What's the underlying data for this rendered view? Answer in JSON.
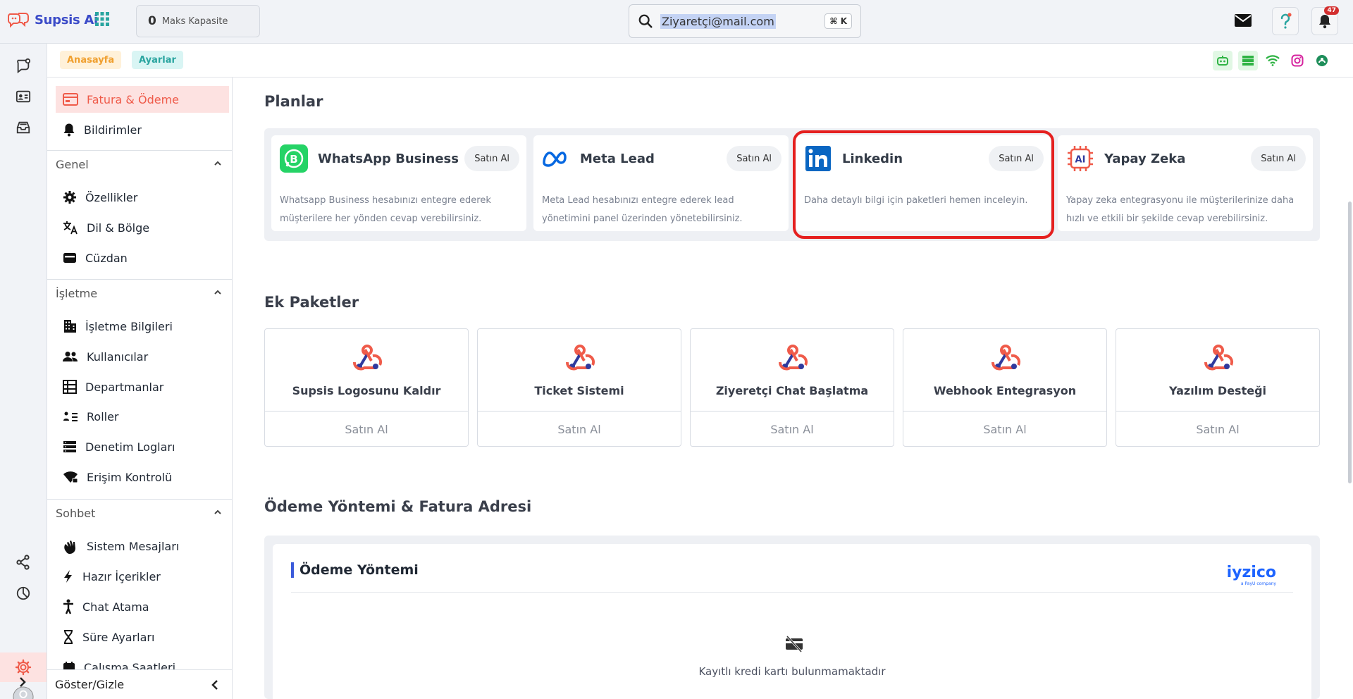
{
  "topbar": {
    "logo_text": "Supsis Ai",
    "capacity_value": "0",
    "capacity_label": "Maks Kapasite",
    "search_value": "Ziyaretçi@mail.com",
    "search_shortcut": "⌘ K",
    "notification_count": "47"
  },
  "breadcrumbs": [
    "Anasayfa",
    "Ayarlar"
  ],
  "sidebar": {
    "top_items": [
      {
        "label": "Fatura & Ödeme",
        "icon": "invoice-icon",
        "active": true
      },
      {
        "label": "Bildirimler",
        "icon": "bell-icon"
      }
    ],
    "sections": [
      {
        "title": "Genel",
        "items": [
          {
            "label": "Özellikler",
            "icon": "gear-icon"
          },
          {
            "label": "Dil & Bölge",
            "icon": "translate-icon"
          },
          {
            "label": "Cüzdan",
            "icon": "wallet-icon"
          }
        ]
      },
      {
        "title": "İşletme",
        "items": [
          {
            "label": "İşletme Bilgileri",
            "icon": "building-icon"
          },
          {
            "label": "Kullanıcılar",
            "icon": "users-icon"
          },
          {
            "label": "Departmanlar",
            "icon": "department-icon"
          },
          {
            "label": "Roller",
            "icon": "roles-icon"
          },
          {
            "label": "Denetim Logları",
            "icon": "logs-icon"
          },
          {
            "label": "Erişim Kontrolü",
            "icon": "access-icon"
          }
        ]
      },
      {
        "title": "Sohbet",
        "items": [
          {
            "label": "Sistem Mesajları",
            "icon": "hand-wave-icon"
          },
          {
            "label": "Hazır İçerikler",
            "icon": "bolt-icon"
          },
          {
            "label": "Chat Atama",
            "icon": "person-icon"
          },
          {
            "label": "Süre Ayarları",
            "icon": "hourglass-icon"
          },
          {
            "label": "Çalışma Saatleri",
            "icon": "calendar-icon"
          }
        ]
      }
    ],
    "footer_label": "Göster/Gizle"
  },
  "main": {
    "plans_title": "Planlar",
    "plans": [
      {
        "title": "WhatsApp Business",
        "button": "Satın Al",
        "description": "Whatsapp Business hesabınızı entegre ederek müşterilere her yönden cevap verebilirsiniz.",
        "icon": "whatsapp-icon"
      },
      {
        "title": "Meta Lead",
        "button": "Satın Al",
        "description": "Meta Lead hesabınızı entegre ederek lead yönetimini panel üzerinden yönetebilirsiniz.",
        "icon": "meta-icon"
      },
      {
        "title": "Linkedin",
        "button": "Satın Al",
        "description": "Daha detaylı bilgi için paketleri hemen inceleyin.",
        "icon": "linkedin-icon"
      },
      {
        "title": "Yapay Zeka",
        "button": "Satın Al",
        "description": "Yapay zeka entegrasyonu ile müşterilerinize daha hızlı ve etkili bir şekilde cevap verebilirsiniz.",
        "icon": "ai-chip-icon"
      }
    ],
    "addons_title": "Ek Paketler",
    "addons": [
      {
        "title": "Supsis Logosunu Kaldır",
        "button": "Satın Al"
      },
      {
        "title": "Ticket Sistemi",
        "button": "Satın Al"
      },
      {
        "title": "Ziyeretçi Chat Başlatma",
        "button": "Satın Al"
      },
      {
        "title": "Webhook Entegrasyon",
        "button": "Satın Al"
      },
      {
        "title": "Yazılım Desteği",
        "button": "Satın Al"
      }
    ],
    "payment_section_title": "Ödeme Yöntemi & Fatura Adresi",
    "payment_card_title": "Ödeme Yöntemi",
    "payment_brand": "iyzico",
    "payment_brand_sub": "a PayU company",
    "no_card_text": "Kayıtlı kredi kartı bulunmamaktadır"
  },
  "colors": {
    "accent": "#ef5b4a",
    "brand": "#3b4bc8",
    "highlight": "#e5201f"
  }
}
